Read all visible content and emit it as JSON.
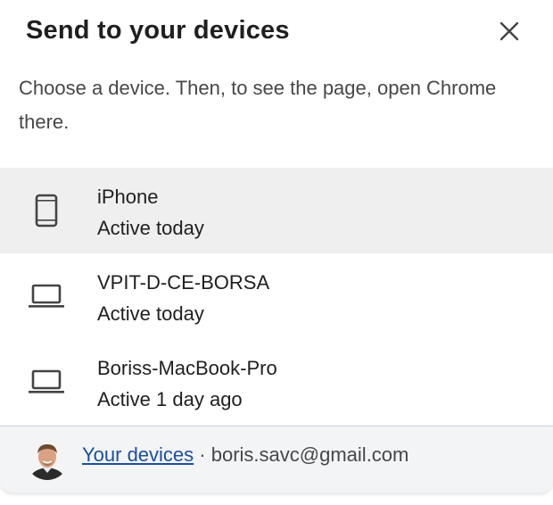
{
  "dialog": {
    "title": "Send to your devices",
    "subtitle": "Choose a device. Then, to see the page, open Chrome there.",
    "close_icon": "close-icon"
  },
  "devices": [
    {
      "name": "iPhone",
      "status": "Active today",
      "icon": "phone-icon",
      "selected": true
    },
    {
      "name": "VPIT-D-CE-BORSA",
      "status": "Active today",
      "icon": "laptop-icon",
      "selected": false
    },
    {
      "name": "Boriss-MacBook-Pro",
      "status": "Active 1 day ago",
      "icon": "laptop-icon",
      "selected": false
    }
  ],
  "footer": {
    "link_label": "Your devices",
    "separator": "·",
    "email": "boris.savc@gmail.com"
  },
  "colors": {
    "selected_row": "#efefef",
    "link": "#1a4f9c",
    "footer_bg": "#f3f4f6"
  }
}
